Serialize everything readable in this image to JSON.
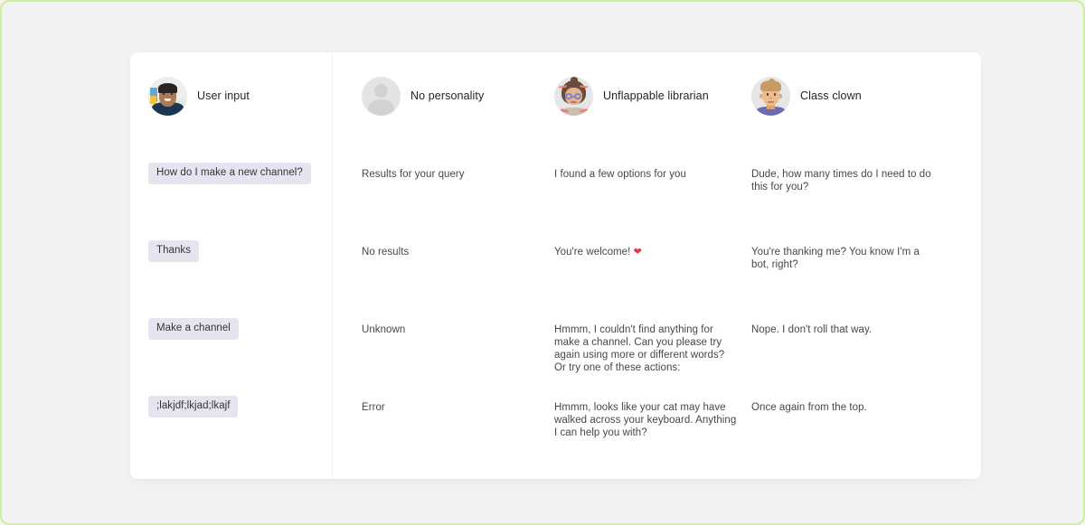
{
  "page": {
    "background_color": "#f3f3f3",
    "card_background": "#ffffff",
    "border_color": "#cdf09a",
    "chip_color": "#e6e5ef",
    "text_color": "#474747",
    "heading_color": "#242424"
  },
  "columns": [
    {
      "key": "user",
      "label": "User input",
      "avatar": "user-photo-avatar",
      "messages": [
        "How do I make a new channel?",
        "Thanks",
        "Make a channel",
        ";lakjdf;lkjad;lkajf"
      ]
    },
    {
      "key": "no_personality",
      "label": "No personality",
      "avatar": "generic-person-avatar",
      "messages": [
        "Results for your query",
        "No results",
        "Unknown",
        "Error"
      ]
    },
    {
      "key": "unflappable_librarian",
      "label": "Unflappable librarian",
      "avatar": "librarian-avatar",
      "messages": [
        "I found a few options for you",
        "You're welcome! ",
        "Hmmm, I couldn't find anything for make a channel. Can you please try again using more or different words? Or try one of these actions:",
        "Hmmm, looks like your cat may have walked across your keyboard. Anything I can help you with?"
      ],
      "emoji": {
        "row": 1,
        "glyph": "❤",
        "name": "red-heart-emoji",
        "color": "#e8373c"
      }
    },
    {
      "key": "class_clown",
      "label": "Class clown",
      "avatar": "clown-avatar",
      "messages": [
        "Dude, how many times do I need to do this for you?",
        "You're thanking me? You know I'm a bot, right?",
        "Nope. I don't roll that way.",
        "Once again from the top."
      ]
    }
  ]
}
